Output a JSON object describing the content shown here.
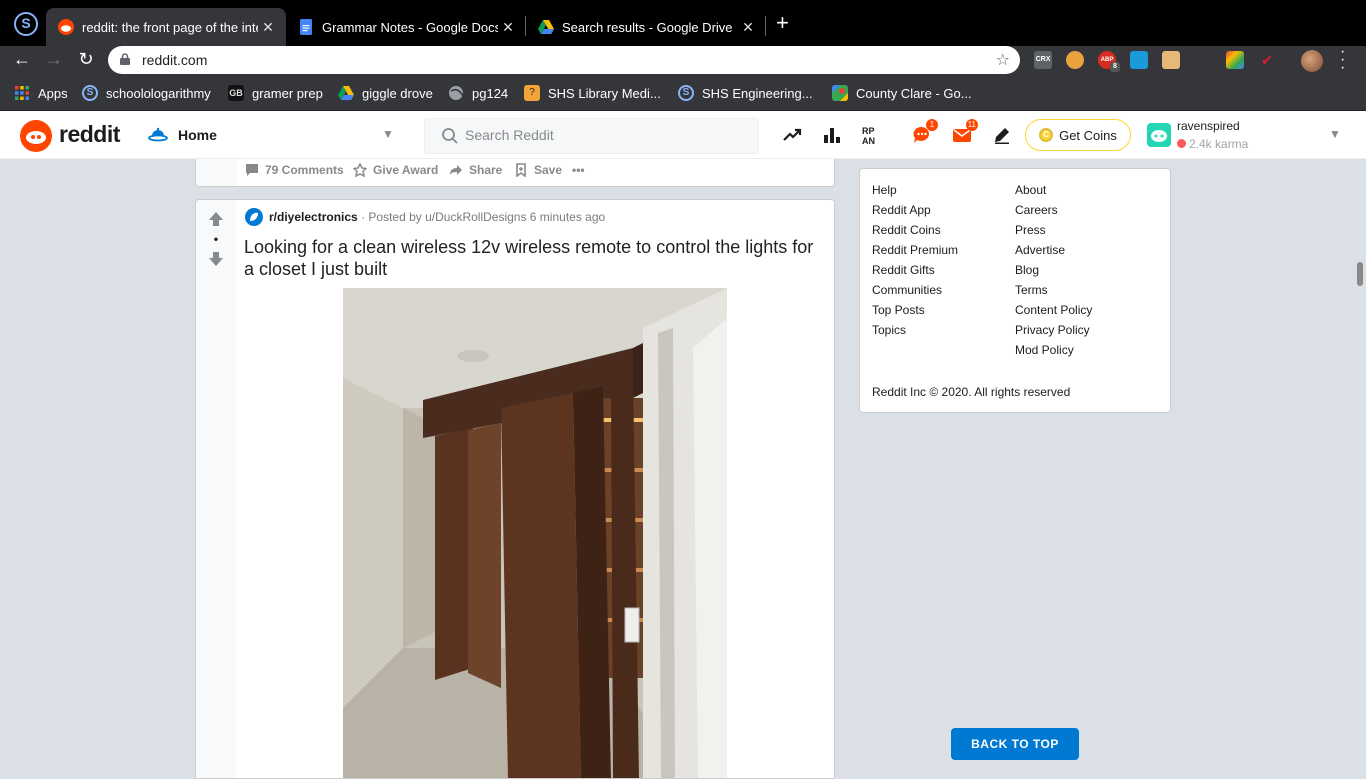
{
  "browser": {
    "tabs": [
      {
        "title": "reddit: the front page of the internet",
        "active": true
      },
      {
        "title": "Grammar Notes - Google Docs",
        "active": false
      },
      {
        "title": "Search results - Google Drive",
        "active": false
      }
    ],
    "url": "reddit.com",
    "extensions": [
      "CRX",
      "ABP",
      "8"
    ],
    "bookmarks": [
      {
        "label": "Apps"
      },
      {
        "label": "schoolologarithmy"
      },
      {
        "label": "gramer prep"
      },
      {
        "label": "giggle drove"
      },
      {
        "label": "pg124"
      },
      {
        "label": "SHS Library Medi..."
      },
      {
        "label": "SHS Engineering..."
      },
      {
        "label": "County Clare - Go..."
      }
    ]
  },
  "reddit_header": {
    "wordmark": "reddit",
    "feed_label": "Home",
    "search_placeholder": "Search Reddit",
    "chat_badge": "1",
    "inbox_badge": "11",
    "get_coins_label": "Get Coins",
    "coin_letter": "C",
    "username": "ravenspired",
    "karma": "2.4k karma"
  },
  "prev_post_actions": {
    "comments": "79 Comments",
    "give_award": "Give Award",
    "share": "Share",
    "save": "Save",
    "more": "•••"
  },
  "post": {
    "vote_count": "•",
    "subreddit": "r/diyelectronics",
    "posted_by": "· Posted by u/DuckRollDesigns 6 minutes ago",
    "title": "Looking for a clean wireless 12v wireless remote to control the lights for a closet I just built"
  },
  "sidebar": {
    "col1": [
      "Help",
      "Reddit App",
      "Reddit Coins",
      "Reddit Premium",
      "Reddit Gifts",
      "Communities",
      "Top Posts",
      "Topics"
    ],
    "col2": [
      "About",
      "Careers",
      "Press",
      "Advertise",
      "Blog",
      "Terms",
      "Content Policy",
      "Privacy Policy",
      "Mod Policy"
    ],
    "copyright": "Reddit Inc © 2020. All rights reserved"
  },
  "back_to_top": "BACK TO TOP",
  "colors": {
    "reddit_orange": "#ff4500",
    "reddit_blue": "#0079d3",
    "page_bg": "#dae0e6"
  }
}
